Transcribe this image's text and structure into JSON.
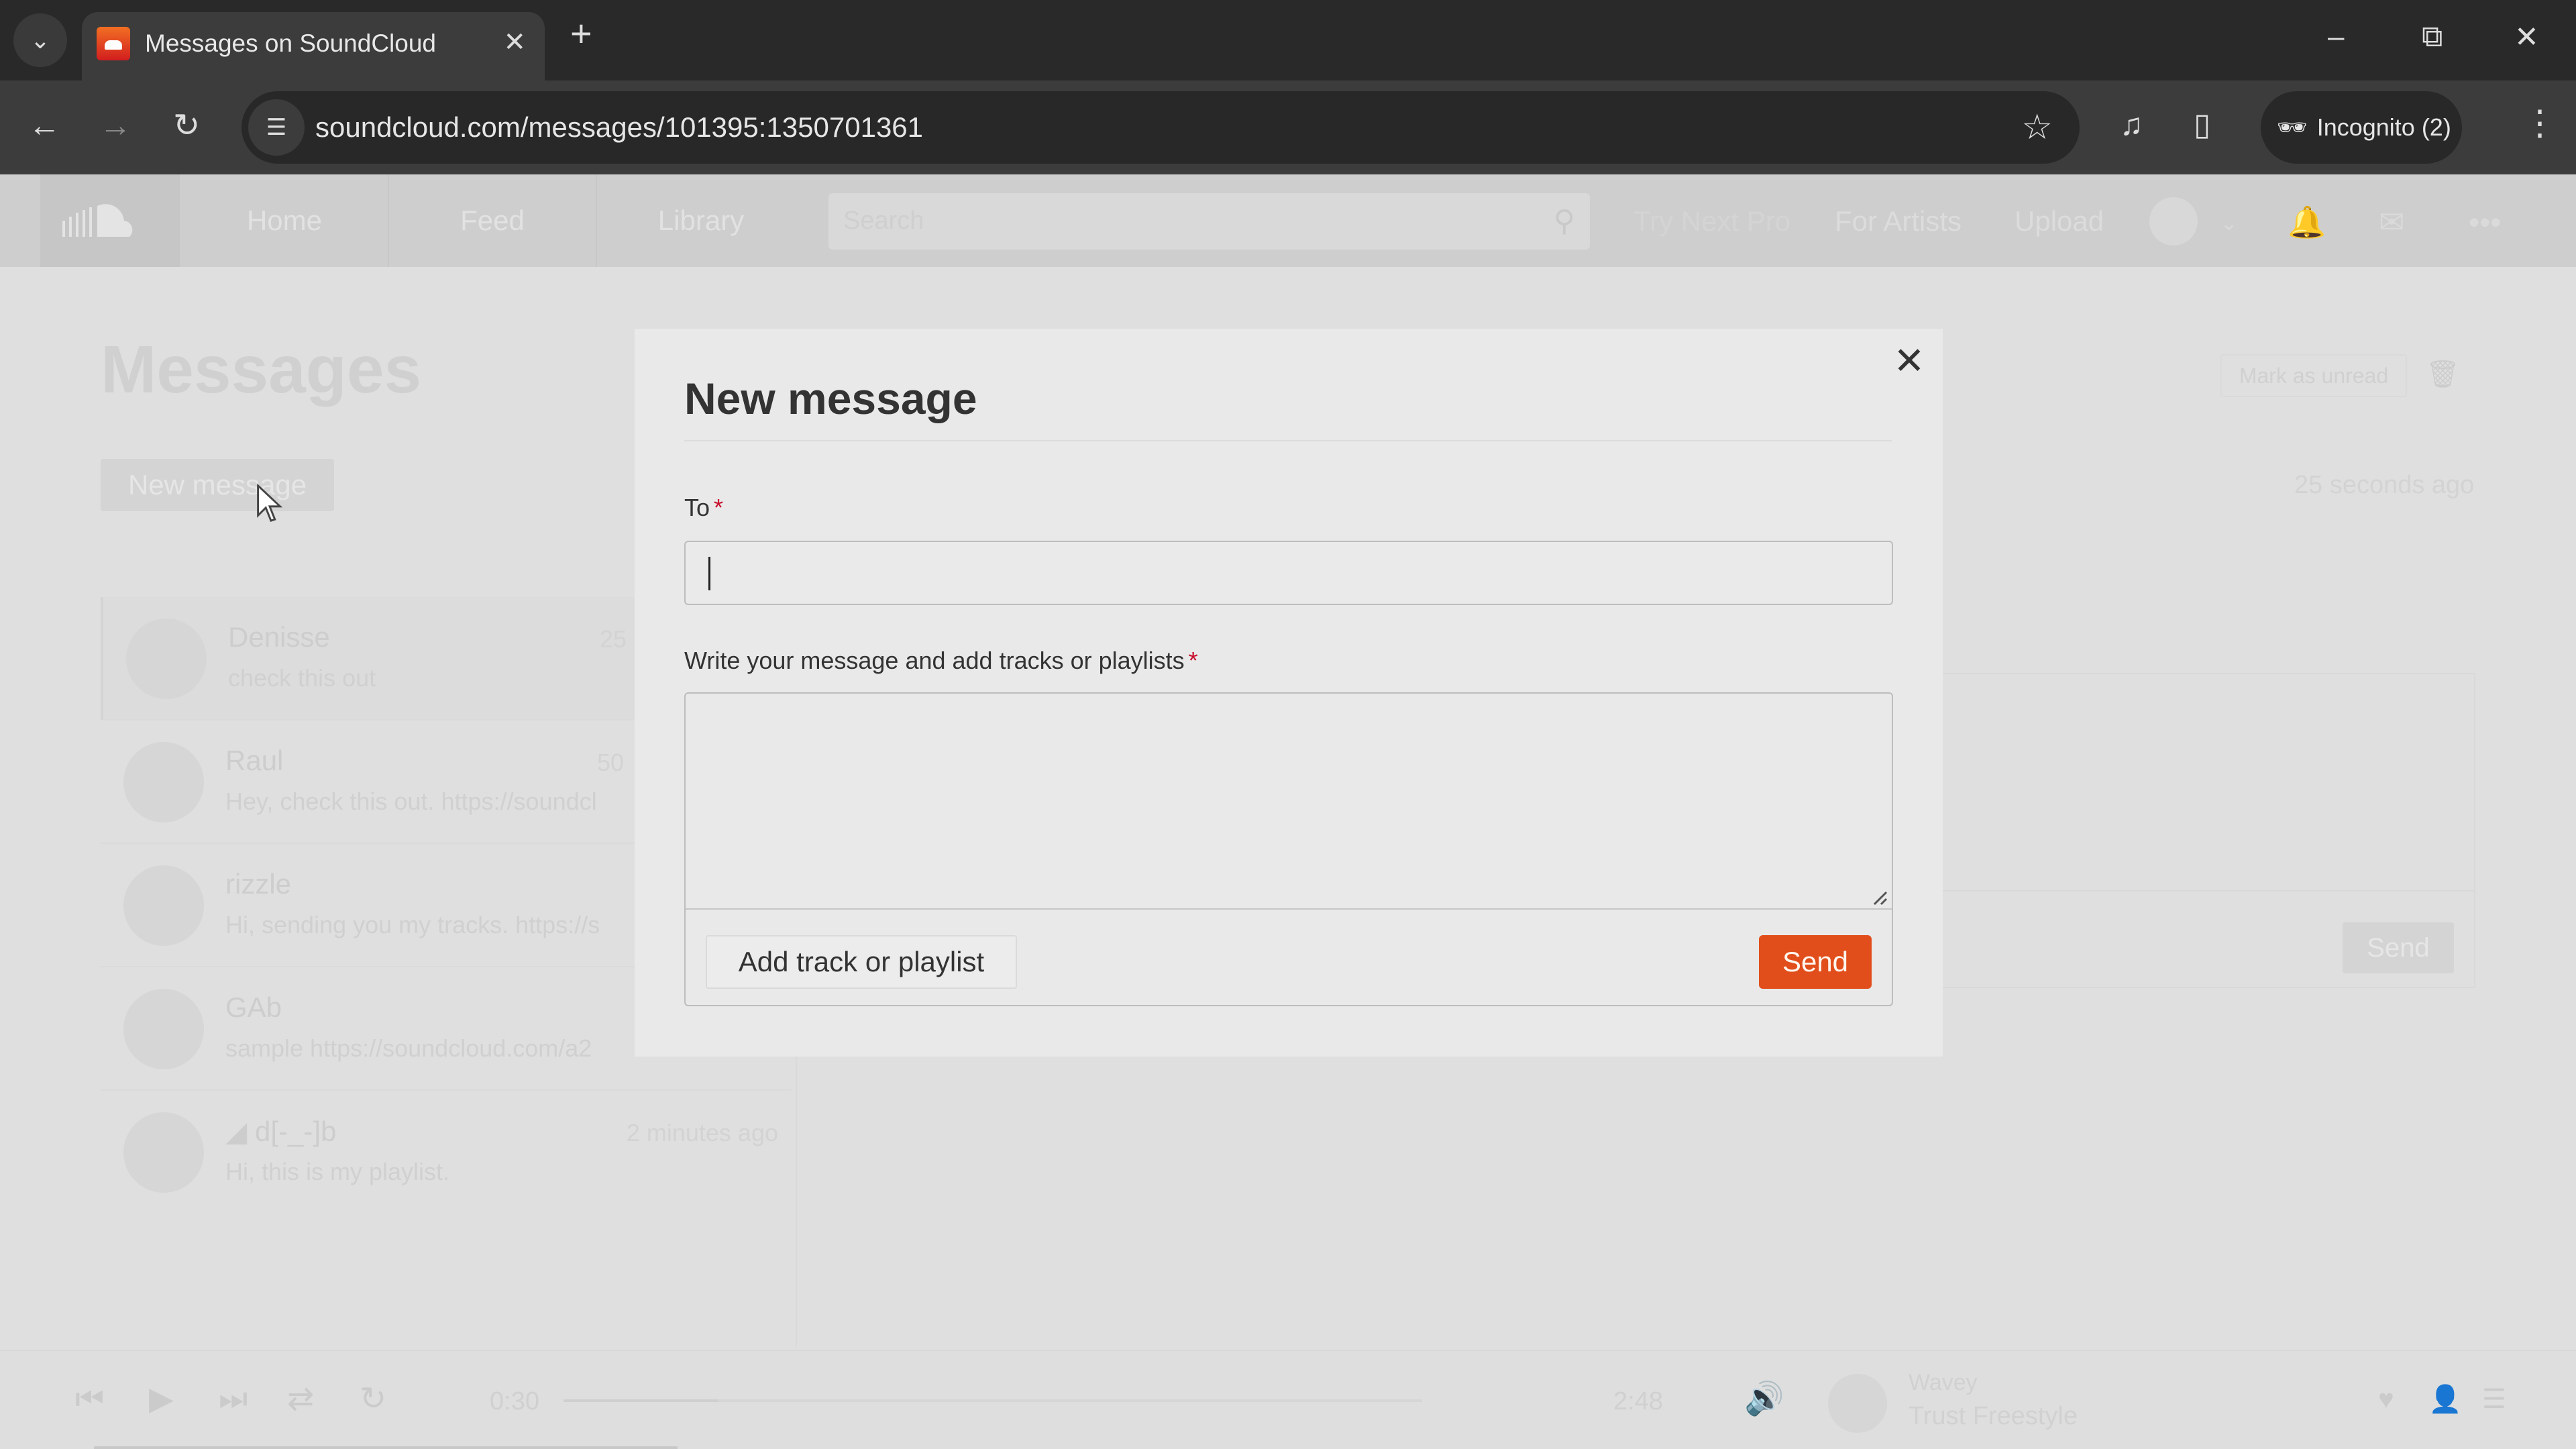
{
  "browser": {
    "tab_title": "Messages on SoundCloud",
    "url": "soundcloud.com/messages/101395:1350701361",
    "incognito_label": "Incognito (2)"
  },
  "header": {
    "nav": [
      "Home",
      "Feed",
      "Library"
    ],
    "search_placeholder": "Search",
    "try_next_pro": "Try Next Pro",
    "for_artists": "For Artists",
    "upload": "Upload"
  },
  "page": {
    "title": "Messages",
    "new_message_button": "New message",
    "mark_as_unread": "Mark as unread",
    "thread_time": "25 seconds ago",
    "reply_send": "Send"
  },
  "conversations": [
    {
      "name": "Denisse",
      "time": "25",
      "preview": "check this out",
      "active": true
    },
    {
      "name": "Raul",
      "time": "50",
      "preview": "Hey, check this out. https://soundcl",
      "active": false
    },
    {
      "name": "rizzle",
      "time": "",
      "preview": "Hi, sending you my tracks. https://s",
      "active": false
    },
    {
      "name": "GAb",
      "time": "",
      "preview": "sample https://soundcloud.com/a2",
      "active": false
    },
    {
      "name": "d[-_-]b",
      "time": "2 minutes ago",
      "preview": "Hi, this is my playlist.",
      "active": false
    }
  ],
  "modal": {
    "title": "New message",
    "to_label": "To",
    "to_value": "",
    "message_label": "Write your message and add tracks or playlists",
    "message_value": "",
    "required_marker": "*",
    "add_track_button": "Add track or playlist",
    "send_button": "Send",
    "send_color": "#e14e1b"
  },
  "player": {
    "elapsed": "0:30",
    "duration": "2:48",
    "progress_fraction": 0.18,
    "artist": "Wavey",
    "track": "Trust Freestyle"
  }
}
